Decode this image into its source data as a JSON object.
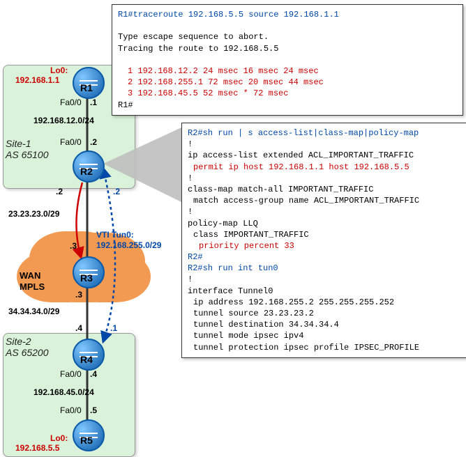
{
  "term1": {
    "prompt": "R1#",
    "cmd": "traceroute 192.168.5.5 source 192.168.1.1",
    "esc": "Type escape sequence to abort.",
    "tracing": "Tracing the route to 192.168.5.5",
    "hop1": "1 192.168.12.2 24 msec 16 msec 24 msec",
    "hop2": "2 192.168.255.1 72 msec 20 msec 44 msec",
    "hop3": "3 192.168.45.5 52 msec *  72 msec",
    "end": "R1#"
  },
  "term2": {
    "prompt": "R2#",
    "cmd1": "sh run | s access-list|class-map|policy-map",
    "acl1": "ip access-list extended ACL_IMPORTANT_TRAFFIC",
    "acl2": "permit ip host 192.168.1.1 host 192.168.5.5",
    "cmap1": "class-map match-all IMPORTANT_TRAFFIC",
    "cmap2": "match access-group name ACL_IMPORTANT_TRAFFIC",
    "pmap1": "policy-map LLQ",
    "pmap2": "class IMPORTANT_TRAFFIC",
    "pmap3": "priority percent 33",
    "end1": "R2#",
    "cmd2": "sh run int tun0",
    "tun1": "interface Tunnel0",
    "tun2": "ip address 192.168.255.2 255.255.255.252",
    "tun3": "tunnel source 23.23.23.2",
    "tun4": "tunnel destination 34.34.34.4",
    "tun5": "tunnel mode ipsec ipv4",
    "tun6": "tunnel protection ipsec profile IPSEC_PROFILE"
  },
  "sites": {
    "s1_name": "Site-1",
    "s1_as": "AS 65100",
    "s2_name": "Site-2",
    "s2_as": "AS 65200"
  },
  "labels": {
    "r1": "R1",
    "r2": "R2",
    "r3": "R3",
    "r4": "R4",
    "r5": "R5",
    "lo0": "Lo0:",
    "r1_lo": "192.168.1.1",
    "r5_lo": "192.168.5.5",
    "fa00": "Fa0/0",
    "d1": ".1",
    "d2": ".2",
    "d3": ".3",
    "d4": ".4",
    "d5": ".5",
    "net12": "192.168.12.0/24",
    "net23": "23.23.23.0/29",
    "net34": "34.34.34.0/29",
    "net45": "192.168.45.0/24",
    "vti_label": "VTI Tun0:",
    "vti_net": "192.168.255.0/29",
    "wan1": "WAN",
    "wan2": "MPLS"
  }
}
